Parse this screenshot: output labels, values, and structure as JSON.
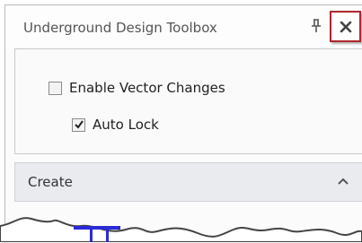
{
  "window": {
    "title": "Underground Design Toolbox",
    "pin_icon": "pin-icon",
    "close_icon": "close-icon"
  },
  "options": {
    "enable_vector_changes": {
      "label": "Enable Vector Changes",
      "checked": false
    },
    "auto_lock": {
      "label": "Auto Lock",
      "checked": true
    }
  },
  "section": {
    "label": "Create",
    "expanded": true,
    "chevron_icon": "chevron-up-icon"
  },
  "colors": {
    "highlight_border": "#b0262d",
    "section_bg": "#e9ebef"
  }
}
